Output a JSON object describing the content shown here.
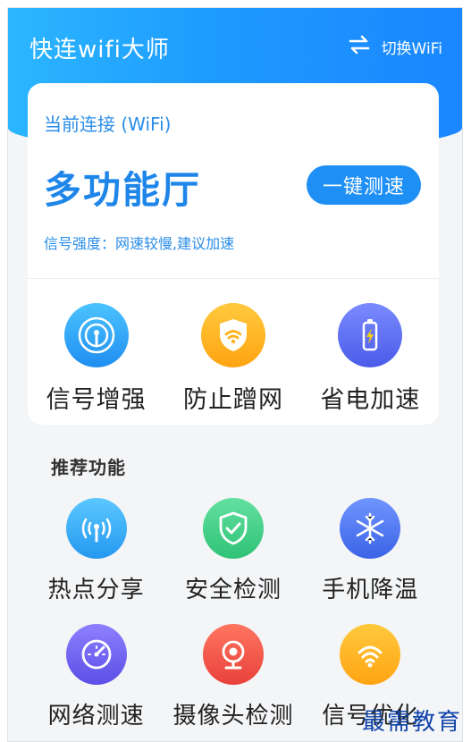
{
  "header": {
    "app_title": "快连wifi大师",
    "switch_label": "切换WiFi",
    "colors": {
      "gradient_start": "#2bb6ff",
      "gradient_end": "#1a86ff"
    }
  },
  "connection": {
    "label": "当前连接 (WiFi)",
    "network_name": "多功能厅",
    "speed_button": "一键测速",
    "signal_status": "信号强度：网速较慢,建议加速"
  },
  "top_features": [
    {
      "label": "信号增强",
      "icon": "signal-icon",
      "color": "#2fa4f5"
    },
    {
      "label": "防止蹭网",
      "icon": "shield-wifi-icon",
      "color": "#ffb21f"
    },
    {
      "label": "省电加速",
      "icon": "battery-icon",
      "color": "#5b6ff0"
    }
  ],
  "recommended": {
    "title": "推荐功能",
    "items": [
      {
        "label": "热点分享",
        "icon": "hotspot-icon",
        "color": "#37b0f6"
      },
      {
        "label": "安全检测",
        "icon": "shield-check-icon",
        "color": "#3fcf83"
      },
      {
        "label": "手机降温",
        "icon": "snowflake-icon",
        "color": "#4e78ef"
      },
      {
        "label": "网络测速",
        "icon": "speedometer-icon",
        "color": "#6f63ef"
      },
      {
        "label": "摄像头检测",
        "icon": "camera-icon",
        "color": "#f2544a"
      },
      {
        "label": "信号优化",
        "icon": "wifi-optimize-icon",
        "color": "#ffb21f"
      }
    ]
  },
  "watermark": "最需教育"
}
